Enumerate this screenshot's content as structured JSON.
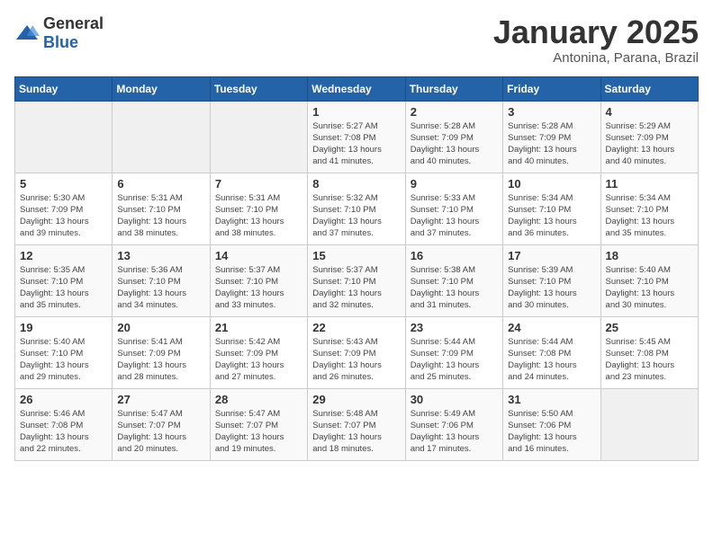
{
  "header": {
    "logo_general": "General",
    "logo_blue": "Blue",
    "month_title": "January 2025",
    "subtitle": "Antonina, Parana, Brazil"
  },
  "weekdays": [
    "Sunday",
    "Monday",
    "Tuesday",
    "Wednesday",
    "Thursday",
    "Friday",
    "Saturday"
  ],
  "weeks": [
    [
      {
        "day": "",
        "info": ""
      },
      {
        "day": "",
        "info": ""
      },
      {
        "day": "",
        "info": ""
      },
      {
        "day": "1",
        "info": "Sunrise: 5:27 AM\nSunset: 7:08 PM\nDaylight: 13 hours\nand 41 minutes."
      },
      {
        "day": "2",
        "info": "Sunrise: 5:28 AM\nSunset: 7:09 PM\nDaylight: 13 hours\nand 40 minutes."
      },
      {
        "day": "3",
        "info": "Sunrise: 5:28 AM\nSunset: 7:09 PM\nDaylight: 13 hours\nand 40 minutes."
      },
      {
        "day": "4",
        "info": "Sunrise: 5:29 AM\nSunset: 7:09 PM\nDaylight: 13 hours\nand 40 minutes."
      }
    ],
    [
      {
        "day": "5",
        "info": "Sunrise: 5:30 AM\nSunset: 7:09 PM\nDaylight: 13 hours\nand 39 minutes."
      },
      {
        "day": "6",
        "info": "Sunrise: 5:31 AM\nSunset: 7:10 PM\nDaylight: 13 hours\nand 38 minutes."
      },
      {
        "day": "7",
        "info": "Sunrise: 5:31 AM\nSunset: 7:10 PM\nDaylight: 13 hours\nand 38 minutes."
      },
      {
        "day": "8",
        "info": "Sunrise: 5:32 AM\nSunset: 7:10 PM\nDaylight: 13 hours\nand 37 minutes."
      },
      {
        "day": "9",
        "info": "Sunrise: 5:33 AM\nSunset: 7:10 PM\nDaylight: 13 hours\nand 37 minutes."
      },
      {
        "day": "10",
        "info": "Sunrise: 5:34 AM\nSunset: 7:10 PM\nDaylight: 13 hours\nand 36 minutes."
      },
      {
        "day": "11",
        "info": "Sunrise: 5:34 AM\nSunset: 7:10 PM\nDaylight: 13 hours\nand 35 minutes."
      }
    ],
    [
      {
        "day": "12",
        "info": "Sunrise: 5:35 AM\nSunset: 7:10 PM\nDaylight: 13 hours\nand 35 minutes."
      },
      {
        "day": "13",
        "info": "Sunrise: 5:36 AM\nSunset: 7:10 PM\nDaylight: 13 hours\nand 34 minutes."
      },
      {
        "day": "14",
        "info": "Sunrise: 5:37 AM\nSunset: 7:10 PM\nDaylight: 13 hours\nand 33 minutes."
      },
      {
        "day": "15",
        "info": "Sunrise: 5:37 AM\nSunset: 7:10 PM\nDaylight: 13 hours\nand 32 minutes."
      },
      {
        "day": "16",
        "info": "Sunrise: 5:38 AM\nSunset: 7:10 PM\nDaylight: 13 hours\nand 31 minutes."
      },
      {
        "day": "17",
        "info": "Sunrise: 5:39 AM\nSunset: 7:10 PM\nDaylight: 13 hours\nand 30 minutes."
      },
      {
        "day": "18",
        "info": "Sunrise: 5:40 AM\nSunset: 7:10 PM\nDaylight: 13 hours\nand 30 minutes."
      }
    ],
    [
      {
        "day": "19",
        "info": "Sunrise: 5:40 AM\nSunset: 7:10 PM\nDaylight: 13 hours\nand 29 minutes."
      },
      {
        "day": "20",
        "info": "Sunrise: 5:41 AM\nSunset: 7:09 PM\nDaylight: 13 hours\nand 28 minutes."
      },
      {
        "day": "21",
        "info": "Sunrise: 5:42 AM\nSunset: 7:09 PM\nDaylight: 13 hours\nand 27 minutes."
      },
      {
        "day": "22",
        "info": "Sunrise: 5:43 AM\nSunset: 7:09 PM\nDaylight: 13 hours\nand 26 minutes."
      },
      {
        "day": "23",
        "info": "Sunrise: 5:44 AM\nSunset: 7:09 PM\nDaylight: 13 hours\nand 25 minutes."
      },
      {
        "day": "24",
        "info": "Sunrise: 5:44 AM\nSunset: 7:08 PM\nDaylight: 13 hours\nand 24 minutes."
      },
      {
        "day": "25",
        "info": "Sunrise: 5:45 AM\nSunset: 7:08 PM\nDaylight: 13 hours\nand 23 minutes."
      }
    ],
    [
      {
        "day": "26",
        "info": "Sunrise: 5:46 AM\nSunset: 7:08 PM\nDaylight: 13 hours\nand 22 minutes."
      },
      {
        "day": "27",
        "info": "Sunrise: 5:47 AM\nSunset: 7:07 PM\nDaylight: 13 hours\nand 20 minutes."
      },
      {
        "day": "28",
        "info": "Sunrise: 5:47 AM\nSunset: 7:07 PM\nDaylight: 13 hours\nand 19 minutes."
      },
      {
        "day": "29",
        "info": "Sunrise: 5:48 AM\nSunset: 7:07 PM\nDaylight: 13 hours\nand 18 minutes."
      },
      {
        "day": "30",
        "info": "Sunrise: 5:49 AM\nSunset: 7:06 PM\nDaylight: 13 hours\nand 17 minutes."
      },
      {
        "day": "31",
        "info": "Sunrise: 5:50 AM\nSunset: 7:06 PM\nDaylight: 13 hours\nand 16 minutes."
      },
      {
        "day": "",
        "info": ""
      }
    ]
  ]
}
